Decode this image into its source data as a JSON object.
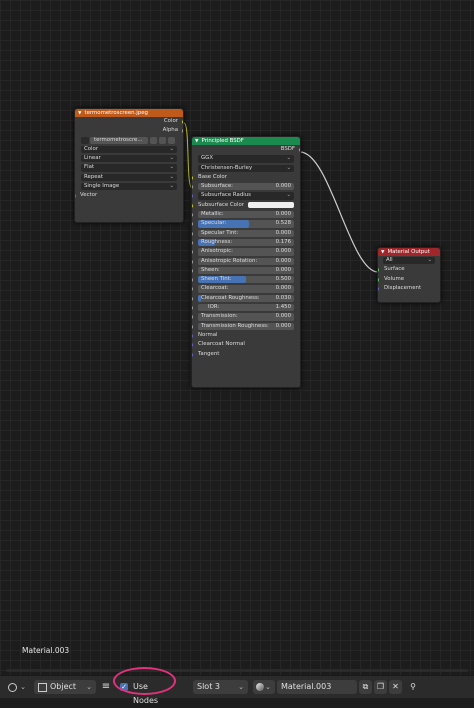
{
  "nodes": {
    "image_texture": {
      "title": "termometroscreen.jpeg",
      "outputs": [
        "Color",
        "Alpha"
      ],
      "image_name": "termometroscre...",
      "image_users": "",
      "color_space": "Color",
      "interpolation": "Linear",
      "projection": "Flat",
      "extension": "Repeat",
      "source": "Single Image",
      "vector_input": "Vector",
      "header_color": "#c05a1a"
    },
    "principled_bsdf": {
      "title": "Principled BSDF",
      "output": "BSDF",
      "distribution": "GGX",
      "subsurface_method": "Christensen-Burley",
      "header_color": "#1b8a4e",
      "base_color_label": "Base Color",
      "subsurface": {
        "label": "Subsurface:",
        "value": "0.000"
      },
      "subsurface_radius": "Subsurface Radius",
      "subsurface_color": "Subsurface Color",
      "sliders": [
        {
          "label": "Metallic:",
          "value": "0.000",
          "fill": 0
        },
        {
          "label": "Specular:",
          "value": "0.528",
          "fill": 0.528
        },
        {
          "label": "Specular Tint:",
          "value": "0.000",
          "fill": 0
        },
        {
          "label": "Roughness:",
          "value": "0.176",
          "fill": 0.176
        },
        {
          "label": "Anisotropic:",
          "value": "0.000",
          "fill": 0
        },
        {
          "label": "Anisotropic Rotation:",
          "value": "0.000",
          "fill": 0
        },
        {
          "label": "Sheen:",
          "value": "0.000",
          "fill": 0
        },
        {
          "label": "Sheen Tint:",
          "value": "0.500",
          "fill": 0.5
        },
        {
          "label": "Clearcoat:",
          "value": "0.000",
          "fill": 0
        },
        {
          "label": "Clearcoat Roughness:",
          "value": "0.030",
          "fill": 0.03
        },
        {
          "label": "IOR:",
          "value": "1.450",
          "fill": 0
        },
        {
          "label": "Transmission:",
          "value": "0.000",
          "fill": 0
        },
        {
          "label": "Transmission Roughness:",
          "value": "0.000",
          "fill": 0
        }
      ],
      "vector_inputs": [
        "Normal",
        "Clearcoat Normal",
        "Tangent"
      ]
    },
    "material_output": {
      "title": "Material Output",
      "target": "All",
      "inputs": [
        "Surface",
        "Volume",
        "Displacement"
      ],
      "header_color": "#a0262a"
    }
  },
  "overlay_material_name": "Material.003",
  "header": {
    "mode": "Object",
    "use_nodes_label": "Use Nodes",
    "use_nodes_checked": true,
    "slot": "Slot 3",
    "material_name": "Material.003",
    "highlight_color": "#e2327c"
  }
}
